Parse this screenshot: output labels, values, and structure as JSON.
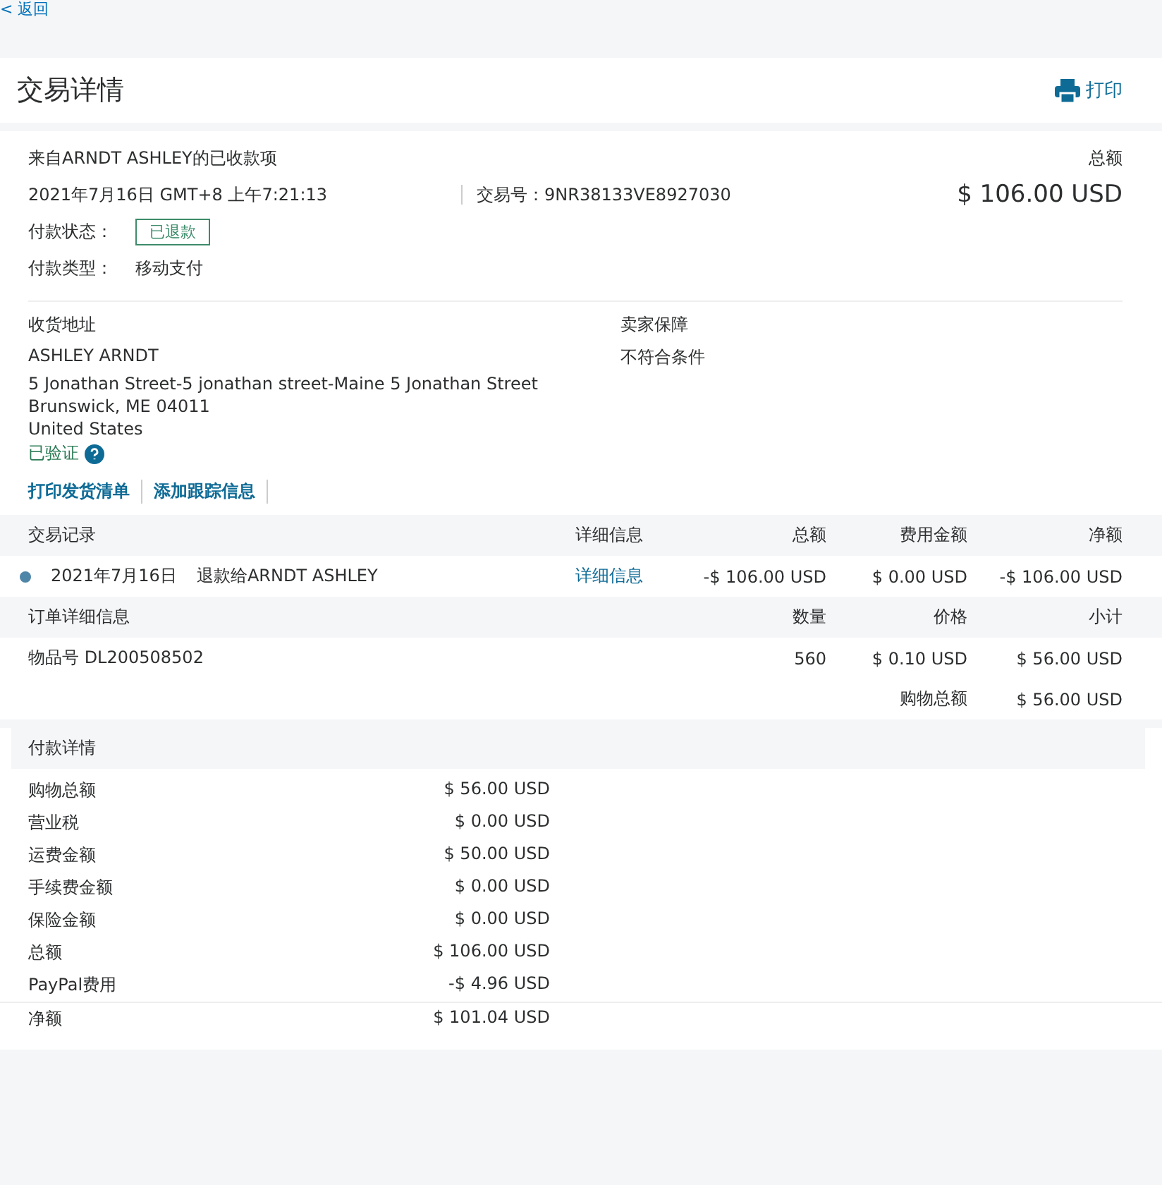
{
  "back_link": "< 返回",
  "title": "交易详情",
  "print_button": "打印",
  "summary": {
    "heading": "来自ARNDT ASHLEY的已收款项",
    "total_label": "总额",
    "datetime": "2021年7月16日 GMT+8 上午7:21:13",
    "transaction_id_label": "交易号：",
    "transaction_id": "9NR38133VE8927030",
    "total_amount": "$ 106.00 USD",
    "status_label": "付款状态：",
    "status": "已退款",
    "payment_type_label": "付款类型：",
    "payment_type": "移动支付"
  },
  "shipping": {
    "label": "收货地址",
    "name": "ASHLEY ARNDT",
    "address_lines": [
      "5 Jonathan Street-5 jonathan street-Maine 5 Jonathan Street",
      "Brunswick, ME 04011",
      "United States"
    ],
    "verified": "已验证"
  },
  "seller_protection": {
    "label": "卖家保障",
    "value": "不符合条件"
  },
  "links": [
    "打印发货清单",
    "添加跟踪信息"
  ],
  "activity": {
    "columns": [
      "交易记录",
      "详细信息",
      "总额",
      "费用金额",
      "净额"
    ],
    "rows": [
      {
        "date": "2021年7月16日",
        "description": "退款给ARNDT ASHLEY",
        "details_link": "详细信息",
        "gross": "-$ 106.00 USD",
        "fee": "$ 0.00 USD",
        "net": "-$ 106.00 USD"
      }
    ]
  },
  "order": {
    "columns": [
      "订单详细信息",
      "数量",
      "价格",
      "小计"
    ],
    "items": [
      {
        "name": "物品号 DL200508502",
        "quantity": "560",
        "price": "$ 0.10 USD",
        "subtotal": "$ 56.00 USD"
      }
    ],
    "total_label": "购物总额",
    "total_value": "$ 56.00 USD"
  },
  "payment_details": {
    "title": "付款详情",
    "rows": [
      {
        "label": "购物总额",
        "value": "$ 56.00 USD"
      },
      {
        "label": "营业税",
        "value": "$ 0.00 USD"
      },
      {
        "label": "运费金额",
        "value": "$ 50.00 USD"
      },
      {
        "label": "手续费金额",
        "value": "$ 0.00 USD"
      },
      {
        "label": "保险金额",
        "value": "$ 0.00 USD"
      },
      {
        "label": "总额",
        "value": "$ 106.00 USD"
      },
      {
        "label": "PayPal费用",
        "value": "-$ 4.96 USD"
      },
      {
        "label": "净额",
        "value": "$ 101.04 USD"
      }
    ]
  }
}
